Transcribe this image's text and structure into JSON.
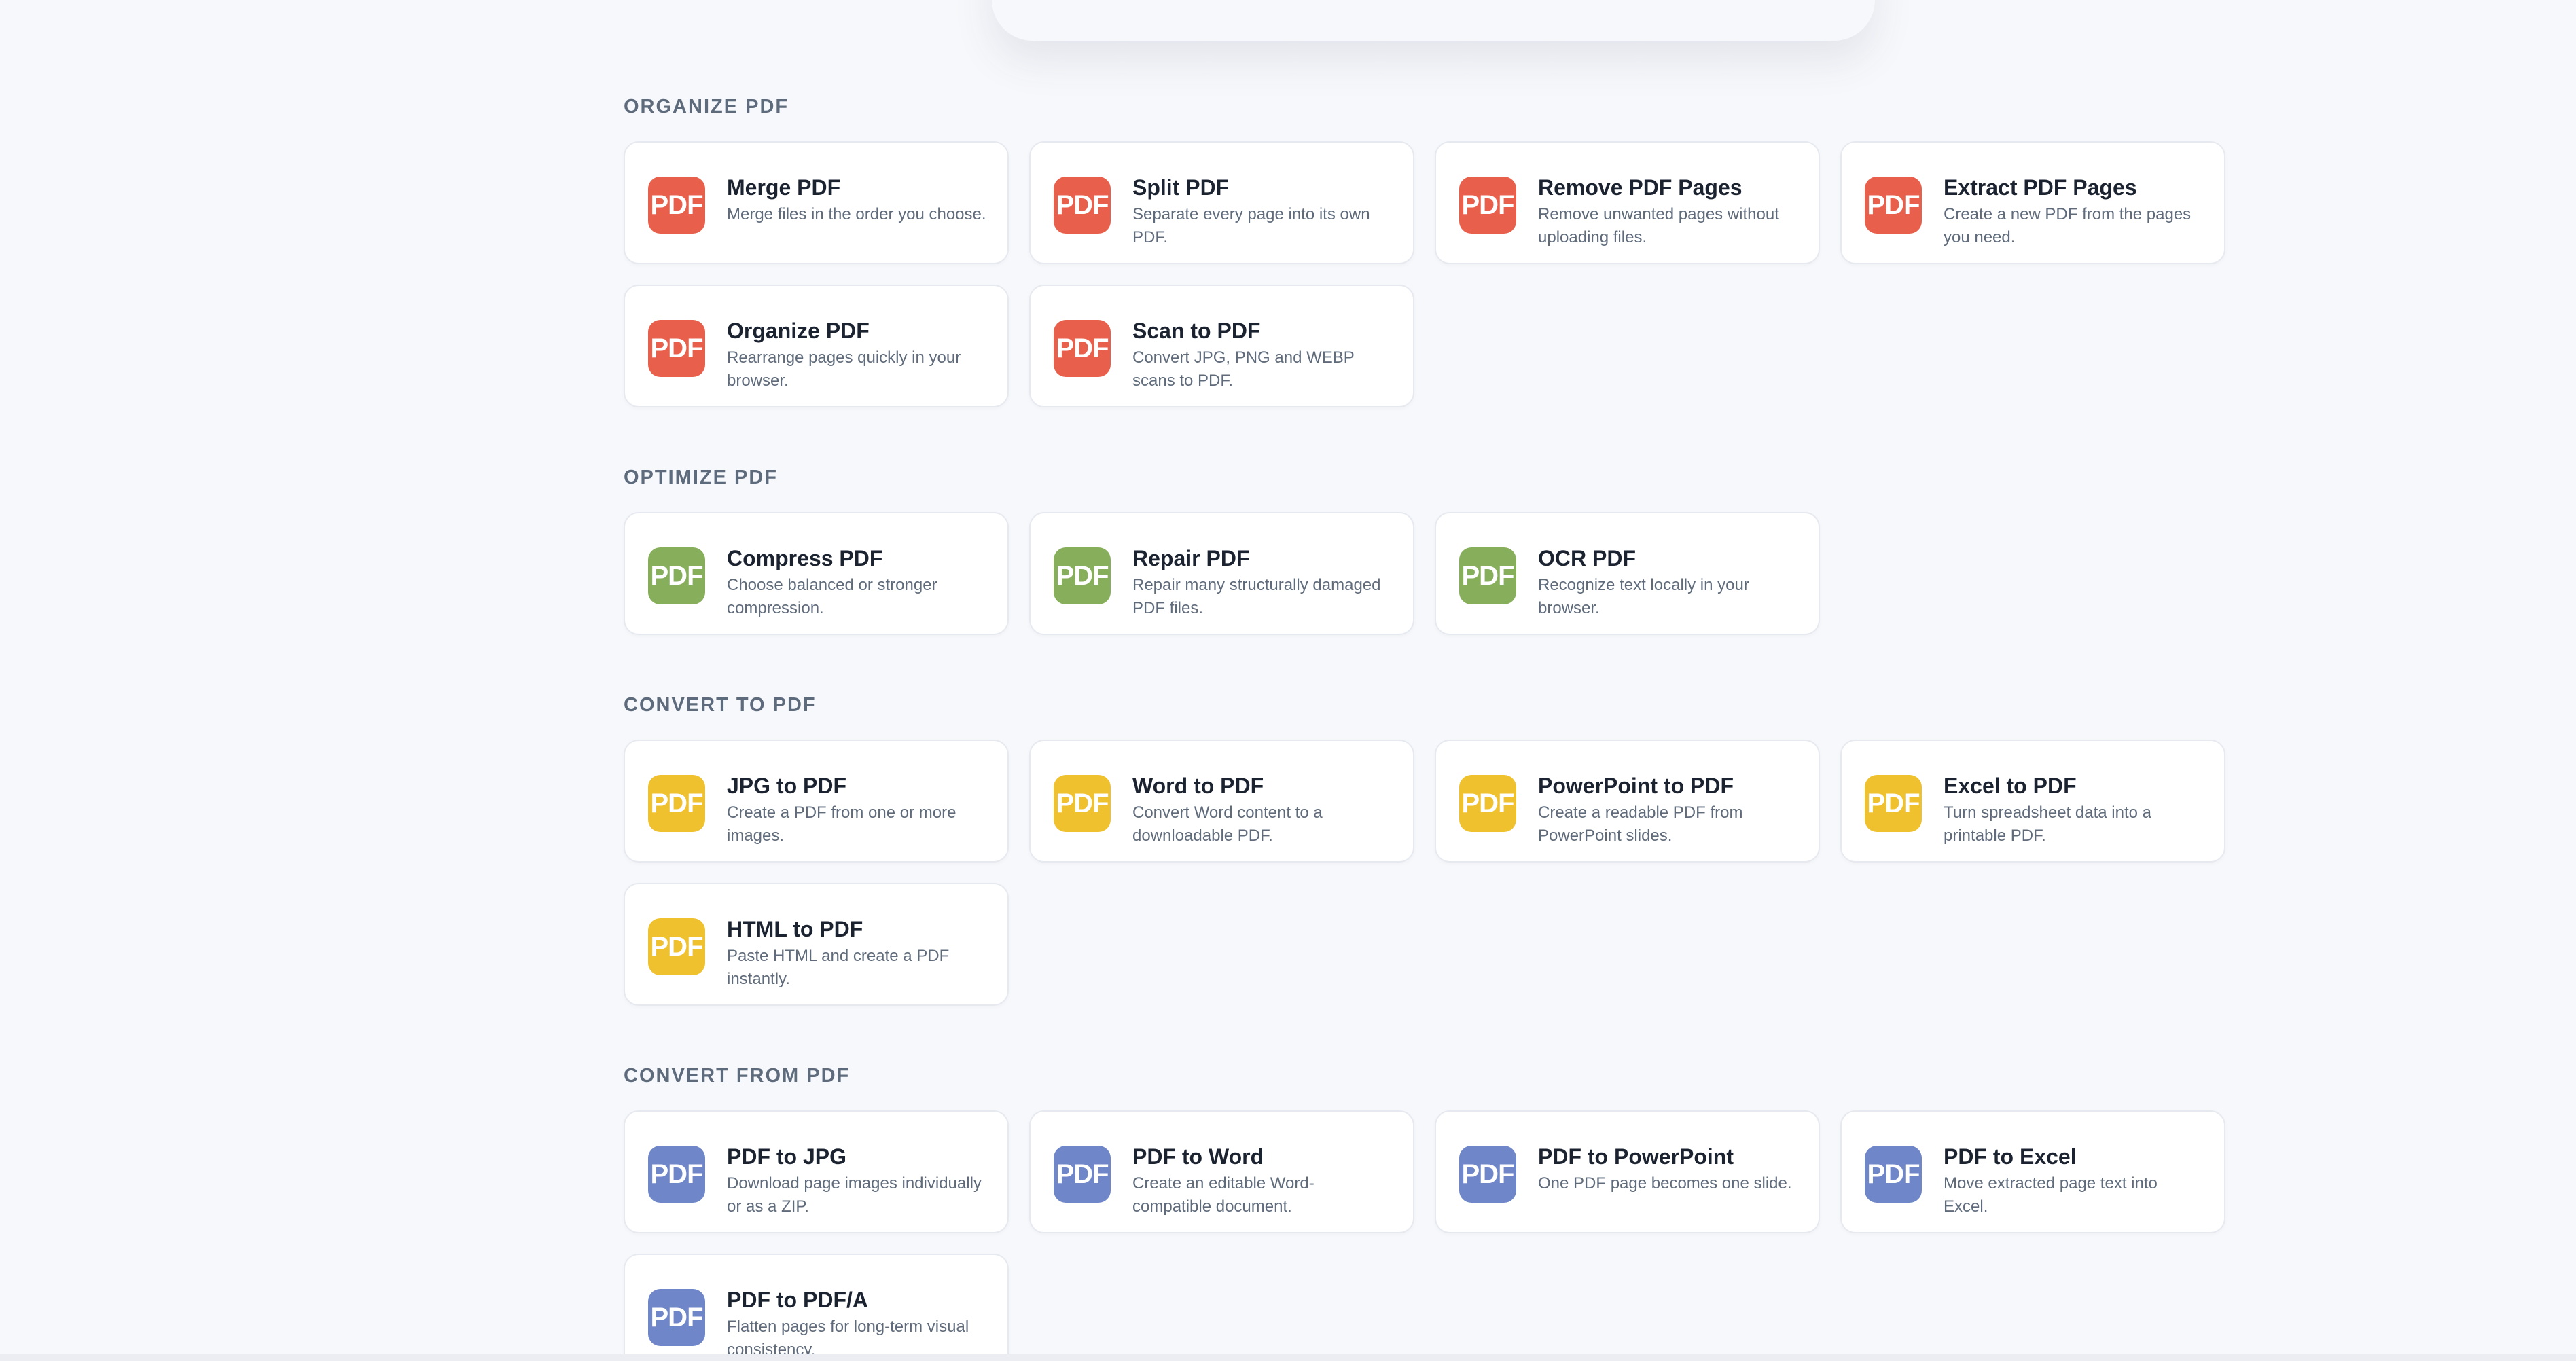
{
  "colors": {
    "organize": "#e8604c",
    "optimize": "#86ae5b",
    "convert_to": "#efc12e",
    "convert_from": "#6f86c8"
  },
  "badge_label": "PDF",
  "sections": [
    {
      "title": "ORGANIZE PDF",
      "color_key": "organize",
      "tools": [
        {
          "title": "Merge PDF",
          "desc": "Merge files in the order you choose."
        },
        {
          "title": "Split PDF",
          "desc": "Separate every page into its own PDF."
        },
        {
          "title": "Remove PDF Pages",
          "desc": "Remove unwanted pages without uploading files."
        },
        {
          "title": "Extract PDF Pages",
          "desc": "Create a new PDF from the pages you need."
        },
        {
          "title": "Organize PDF",
          "desc": "Rearrange pages quickly in your browser."
        },
        {
          "title": "Scan to PDF",
          "desc": "Convert JPG, PNG and WEBP scans to PDF."
        }
      ]
    },
    {
      "title": "OPTIMIZE PDF",
      "color_key": "optimize",
      "tools": [
        {
          "title": "Compress PDF",
          "desc": "Choose balanced or stronger compression."
        },
        {
          "title": "Repair PDF",
          "desc": "Repair many structurally damaged PDF files."
        },
        {
          "title": "OCR PDF",
          "desc": "Recognize text locally in your browser."
        }
      ]
    },
    {
      "title": "CONVERT TO PDF",
      "color_key": "convert_to",
      "tools": [
        {
          "title": "JPG to PDF",
          "desc": "Create a PDF from one or more images."
        },
        {
          "title": "Word to PDF",
          "desc": "Convert Word content to a downloadable PDF."
        },
        {
          "title": "PowerPoint to PDF",
          "desc": "Create a readable PDF from PowerPoint slides."
        },
        {
          "title": "Excel to PDF",
          "desc": "Turn spreadsheet data into a printable PDF."
        },
        {
          "title": "HTML to PDF",
          "desc": "Paste HTML and create a PDF instantly."
        }
      ]
    },
    {
      "title": "CONVERT FROM PDF",
      "color_key": "convert_from",
      "tools": [
        {
          "title": "PDF to JPG",
          "desc": "Download page images individually or as a ZIP."
        },
        {
          "title": "PDF to Word",
          "desc": "Create an editable Word-compatible document."
        },
        {
          "title": "PDF to PowerPoint",
          "desc": "One PDF page becomes one slide."
        },
        {
          "title": "PDF to Excel",
          "desc": "Move extracted page text into Excel."
        },
        {
          "title": "PDF to PDF/A",
          "desc": "Flatten pages for long-term visual consistency."
        }
      ]
    }
  ]
}
